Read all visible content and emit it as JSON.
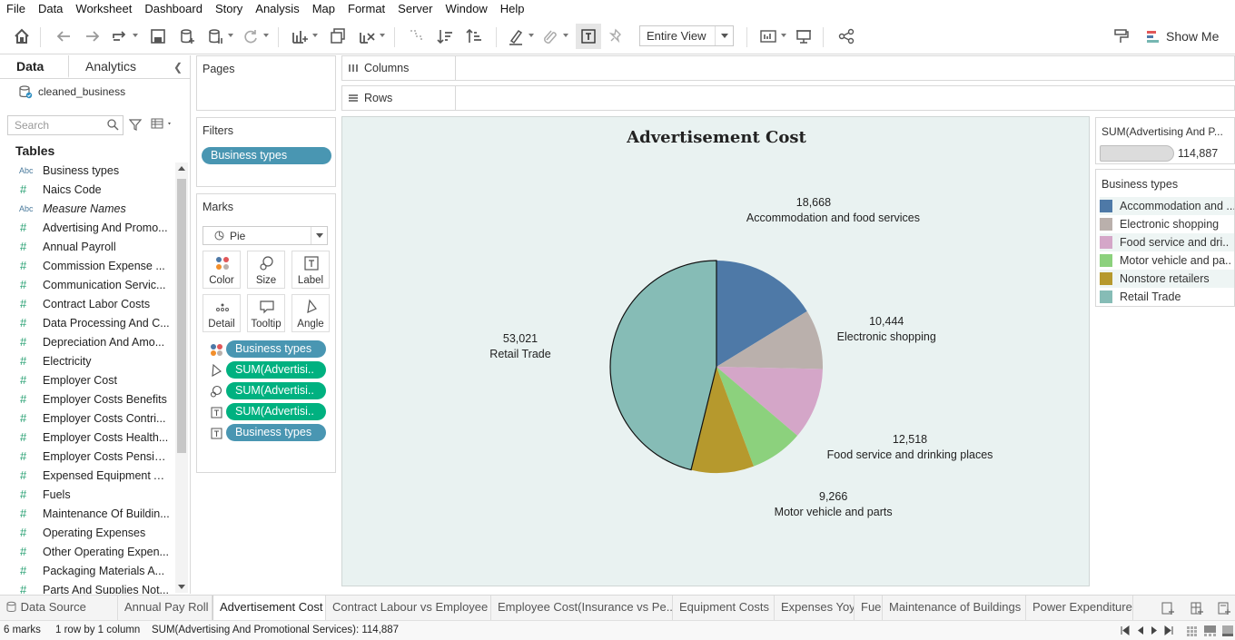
{
  "menu": [
    "File",
    "Data",
    "Worksheet",
    "Dashboard",
    "Story",
    "Analysis",
    "Map",
    "Format",
    "Server",
    "Window",
    "Help"
  ],
  "toolbar": {
    "view_mode": "Entire View",
    "show_me": "Show Me",
    "icons": [
      "home-icon",
      "undo-icon",
      "redo-icon",
      "replay-icon",
      "save-icon",
      "new-datasource-icon",
      "pause-updates-icon",
      "refresh-icon",
      "new-worksheet-icon",
      "duplicate-icon",
      "clear-sheet-icon",
      "swap-icon",
      "sort-ascending-icon",
      "sort-descending-icon",
      "highlight-icon",
      "group-icon",
      "show-labels-icon",
      "fix-axes-icon",
      "show-cards-icon",
      "presentation-icon",
      "share-icon",
      "format-painter-icon"
    ]
  },
  "datapane": {
    "tab_data": "Data",
    "tab_analytics": "Analytics",
    "datasource": "cleaned_business",
    "search_placeholder": "Search",
    "tables_heading": "Tables",
    "fields": [
      {
        "type": "Abc",
        "name": "Business types"
      },
      {
        "type": "#",
        "name": "Naics Code"
      },
      {
        "type": "Abc",
        "name": "Measure Names",
        "italic": true
      },
      {
        "type": "#",
        "name": "Advertising And Promo..."
      },
      {
        "type": "#",
        "name": "Annual Payroll"
      },
      {
        "type": "#",
        "name": "Commission Expense ..."
      },
      {
        "type": "#",
        "name": "Communication Servic..."
      },
      {
        "type": "#",
        "name": "Contract Labor Costs"
      },
      {
        "type": "#",
        "name": "Data Processing And C..."
      },
      {
        "type": "#",
        "name": "Depreciation And Amo..."
      },
      {
        "type": "#",
        "name": "Electricity"
      },
      {
        "type": "#",
        "name": "Employer Cost"
      },
      {
        "type": "#",
        "name": "Employer Costs Benefits"
      },
      {
        "type": "#",
        "name": "Employer Costs Contri..."
      },
      {
        "type": "#",
        "name": "Employer Costs Health..."
      },
      {
        "type": "#",
        "name": "Employer Costs Pensio..."
      },
      {
        "type": "#",
        "name": "Expensed Equipment A..."
      },
      {
        "type": "#",
        "name": "Fuels"
      },
      {
        "type": "#",
        "name": "Maintenance Of Buildin..."
      },
      {
        "type": "#",
        "name": "Operating Expenses"
      },
      {
        "type": "#",
        "name": "Other Operating Expen..."
      },
      {
        "type": "#",
        "name": "Packaging Materials A..."
      },
      {
        "type": "#",
        "name": "Parts And Supplies Not..."
      }
    ]
  },
  "pages": {
    "title": "Pages"
  },
  "filters": {
    "title": "Filters",
    "pill": "Business types"
  },
  "marks": {
    "title": "Marks",
    "type": "Pie",
    "buttons": [
      "Color",
      "Size",
      "Label",
      "Detail",
      "Tooltip",
      "Angle"
    ],
    "pills": [
      {
        "icon": "color-dots-icon",
        "label": "Business types",
        "kind": "dim"
      },
      {
        "icon": "angle-icon",
        "label": "SUM(Advertisi..",
        "kind": "meas"
      },
      {
        "icon": "size-icon",
        "label": "SUM(Advertisi..",
        "kind": "meas"
      },
      {
        "icon": "label-icon",
        "label": "SUM(Advertisi..",
        "kind": "meas"
      },
      {
        "icon": "label-icon",
        "label": "Business types",
        "kind": "dim"
      }
    ]
  },
  "shelves": {
    "columns": "Columns",
    "rows": "Rows"
  },
  "viz": {
    "title": "Advertisement Cost"
  },
  "chart_data": {
    "type": "pie",
    "title": "Advertisement Cost",
    "categories": [
      "Accommodation and food services",
      "Electronic shopping",
      "Food service and drinking places",
      "Motor vehicle and parts",
      "Nonstore retailers",
      "Retail Trade"
    ],
    "values": [
      18668,
      10444,
      12518,
      9266,
      10970,
      53021
    ],
    "labels_shown": [
      "18,668",
      "10,444",
      "12,518",
      "9,266",
      "",
      "53,021"
    ],
    "colors": [
      "#4e79a7",
      "#bab0ac",
      "#d4a6c8",
      "#8cd17d",
      "#b6992d",
      "#86bcb6"
    ],
    "legend_placement": "right"
  },
  "size_legend": {
    "title": "SUM(Advertising And P...",
    "value": "114,887"
  },
  "color_legend": {
    "title": "Business types",
    "items": [
      "Accommodation and ...",
      "Electronic shopping",
      "Food service and dri..",
      "Motor vehicle and pa..",
      "Nonstore retailers",
      "Retail Trade"
    ]
  },
  "sheet_tabs": {
    "datasource": "Data Source",
    "sheets": [
      "Annual Pay Roll",
      "Advertisement Cost",
      "Contract Labour vs Employee",
      "Employee Cost(Insurance vs Pe...",
      "Equipment Costs",
      "Expenses Yoy",
      "Fuel",
      "Maintenance of Buildings",
      "Power Expenditure"
    ],
    "active": "Advertisement Cost"
  },
  "status": {
    "marks": "6 marks",
    "rows_cols": "1 row by 1 column",
    "sum": "SUM(Advertising And Promotional Services): 114,887"
  }
}
